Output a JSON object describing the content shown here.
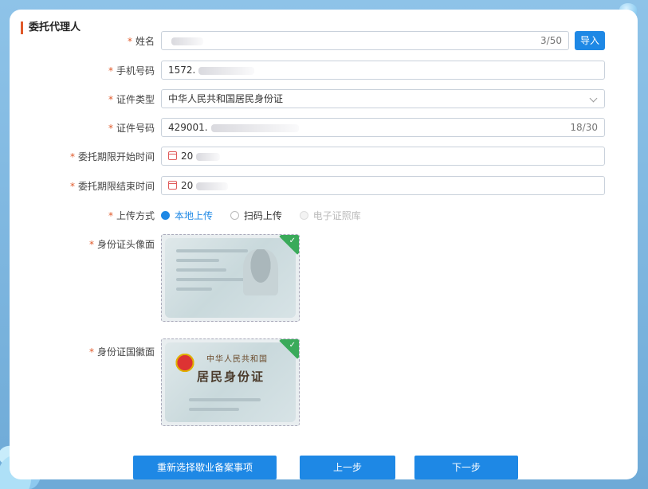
{
  "section": {
    "title": "委托代理人"
  },
  "fields": {
    "name": {
      "label": "姓名",
      "value": "",
      "count": "3/50",
      "import_label": "导入"
    },
    "phone": {
      "label": "手机号码",
      "value": "1572."
    },
    "id_type": {
      "label": "证件类型",
      "value": "中华人民共和国居民身份证"
    },
    "id_number": {
      "label": "证件号码",
      "value": "429001.",
      "count": "18/30"
    },
    "start_date": {
      "label": "委托期限开始时间",
      "value": "20"
    },
    "end_date": {
      "label": "委托期限结束时间",
      "value": "20"
    },
    "upload_method": {
      "label": "上传方式",
      "options": [
        "本地上传",
        "扫码上传",
        "电子证照库"
      ],
      "selected": "本地上传"
    },
    "id_front": {
      "label": "身份证头像面"
    },
    "id_back": {
      "label": "身份证国徽面",
      "card_title": "中华人民共和国",
      "card_subtitle": "居民身份证"
    }
  },
  "required_mark": "*",
  "buttons": {
    "reselect": "重新选择歇业备案事项",
    "prev": "上一步",
    "next": "下一步"
  },
  "colors": {
    "primary": "#1e88e5",
    "required": "#e05a2b",
    "success": "#3aaa5a"
  }
}
